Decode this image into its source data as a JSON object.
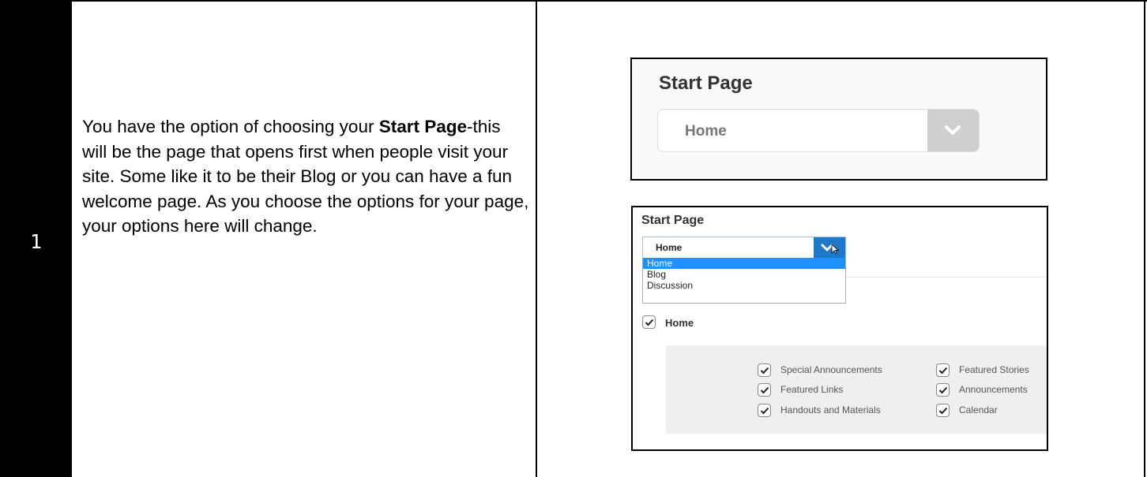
{
  "step_number": "1",
  "instructions": {
    "prefix": "You have the option of choosing your ",
    "bold": "Start Page",
    "suffix": "-this will be the page that opens first when people visit your site. Some like it to be their Blog or you can have a fun welcome page.  As you choose the options for your page, your options here will change."
  },
  "screenshot_1": {
    "title": "Start Page",
    "selected": "Home",
    "dropdown_icon": "chevron-down-icon"
  },
  "screenshot_2": {
    "title": "Start Page",
    "selected": "Home",
    "options": [
      {
        "label": "Home",
        "selected": true
      },
      {
        "label": "Blog",
        "selected": false
      },
      {
        "label": "Discussion",
        "selected": false
      }
    ],
    "home_checkbox": {
      "label": "Home",
      "checked": true
    },
    "sections_left": [
      {
        "label": "Special Announcements",
        "checked": true
      },
      {
        "label": "Featured Links",
        "checked": true
      },
      {
        "label": "Handouts and Materials",
        "checked": true
      }
    ],
    "sections_right": [
      {
        "label": "Featured Stories",
        "checked": true
      },
      {
        "label": "Announcements",
        "checked": true
      },
      {
        "label": "Calendar",
        "checked": true
      }
    ]
  },
  "colors": {
    "accent_blue": "#1e78c8",
    "highlight_blue": "#1e90ff",
    "panel_gray": "#efefef"
  }
}
